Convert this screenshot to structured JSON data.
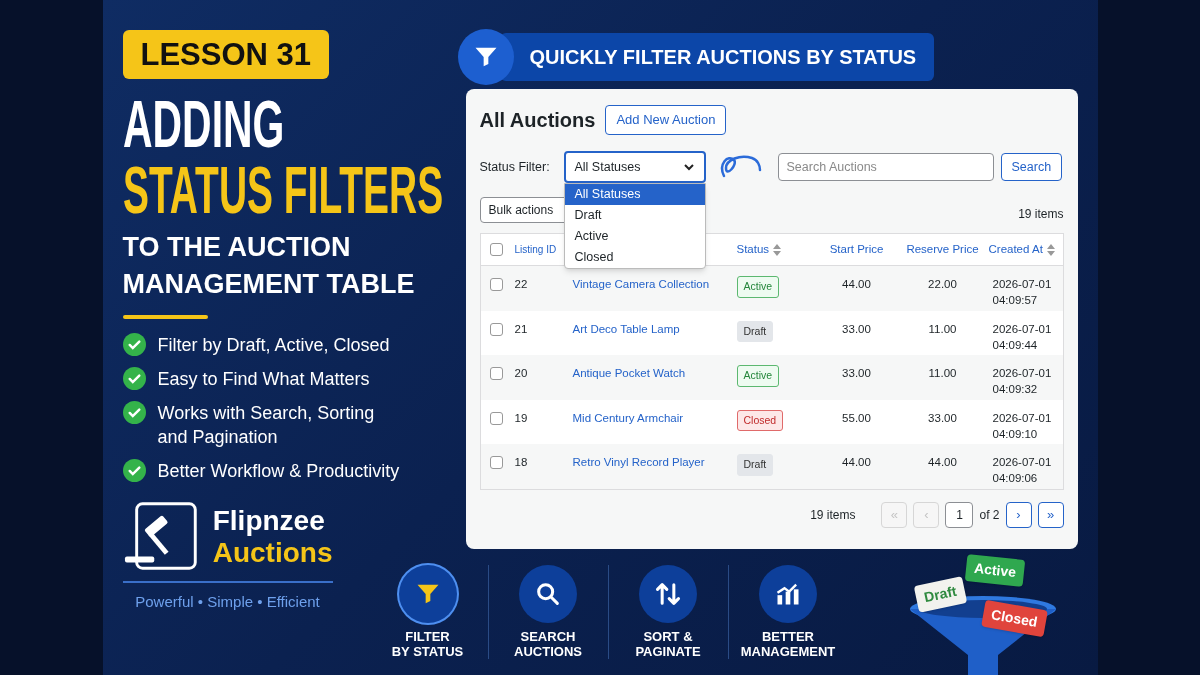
{
  "lesson_badge": "LESSON 31",
  "headline": {
    "line_1": "ADDING",
    "line_2": "STATUS FILTERS",
    "subtitle_lines": [
      "TO THE AUCTION",
      "MANAGEMENT TABLE"
    ]
  },
  "features": [
    {
      "text": "Filter by Draft, Active, Closed",
      "checked": true
    },
    {
      "text": "Easy to Find What Matters",
      "checked": true
    },
    {
      "text": "Works with Search, Sorting and Pagination",
      "checked": true
    },
    {
      "text": "Better Workflow & Productivity",
      "checked": true
    }
  ],
  "brand": {
    "name": "Flipnzee",
    "product": "Auctions",
    "tagline": "Powerful • Simple • Efficient"
  },
  "banner": "QUICKLY FILTER AUCTIONS BY STATUS",
  "app": {
    "title": "All Auctions",
    "add_button": "Add New Auction",
    "filter_label": "Status Filter:",
    "status_select": {
      "value": "All Statuses",
      "expanded": true,
      "options": [
        {
          "label": "All Statuses",
          "selected": true
        },
        {
          "label": "Draft",
          "selected": false
        },
        {
          "label": "Active",
          "selected": false
        },
        {
          "label": "Closed",
          "selected": false
        }
      ]
    },
    "search": {
      "placeholder": "Search Auctions",
      "button": "Search"
    },
    "bulk_actions": "Bulk actions",
    "item_count_top": "19 items",
    "table": {
      "header_checked": false,
      "columns": [
        {
          "kind": "plain",
          "label": "Listing ID"
        },
        {
          "kind": "covered"
        },
        {
          "kind": "sortable",
          "label": "Status"
        },
        {
          "kind": "plain",
          "label": "Start Price"
        },
        {
          "kind": "plain",
          "label": "Reserve Price"
        },
        {
          "kind": "sortable",
          "label": "Created At"
        }
      ],
      "rows": [
        {
          "checked": false,
          "id": "22",
          "title": "Vintage Camera Collection",
          "status": {
            "kind": "active",
            "label": "Active"
          },
          "start_price": "44.00",
          "reserve_price": "22.00",
          "created_date": "2026-07-01",
          "created_time": "04:09:57"
        },
        {
          "checked": false,
          "id": "21",
          "title": "Art Deco Table Lamp",
          "status": {
            "kind": "draft",
            "label": "Draft"
          },
          "start_price": "33.00",
          "reserve_price": "11.00",
          "created_date": "2026-07-01",
          "created_time": "04:09:44"
        },
        {
          "checked": false,
          "id": "20",
          "title": "Antique Pocket Watch",
          "status": {
            "kind": "active",
            "label": "Active"
          },
          "start_price": "33.00",
          "reserve_price": "11.00",
          "created_date": "2026-07-01",
          "created_time": "04:09:32"
        },
        {
          "checked": false,
          "id": "19",
          "title": "Mid Century Armchair",
          "status": {
            "kind": "closed",
            "label": "Closed"
          },
          "start_price": "55.00",
          "reserve_price": "33.00",
          "created_date": "2026-07-01",
          "created_time": "04:09:10"
        },
        {
          "checked": false,
          "id": "18",
          "title": "Retro Vinyl Record Player",
          "status": {
            "kind": "draft",
            "label": "Draft"
          },
          "start_price": "44.00",
          "reserve_price": "44.00",
          "created_date": "2026-07-01",
          "created_time": "04:09:06"
        }
      ]
    },
    "pagination": {
      "count": "19 items",
      "first": {
        "label": "«",
        "disabled": true
      },
      "prev": {
        "label": "‹",
        "disabled": true
      },
      "page": "1",
      "of": "of 2",
      "next": {
        "label": "›",
        "disabled": false
      },
      "last": {
        "label": "»",
        "disabled": false
      }
    }
  },
  "highlights": [
    {
      "kind": "filter",
      "lines": [
        "FILTER",
        "BY STATUS"
      ],
      "selected": true
    },
    {
      "kind": "search",
      "lines": [
        "SEARCH",
        "AUCTIONS"
      ],
      "selected": false
    },
    {
      "kind": "sort",
      "lines": [
        "SORT &",
        "PAGINATE"
      ],
      "selected": false
    },
    {
      "kind": "chart",
      "lines": [
        "BETTER",
        "MANAGEMENT"
      ],
      "selected": false
    }
  ],
  "funnel_tags": [
    {
      "label": "Draft",
      "color": "#f2f2ee"
    },
    {
      "label": "Active",
      "color": "#2fa84f"
    },
    {
      "label": "Closed",
      "color": "#e0443c"
    }
  ]
}
